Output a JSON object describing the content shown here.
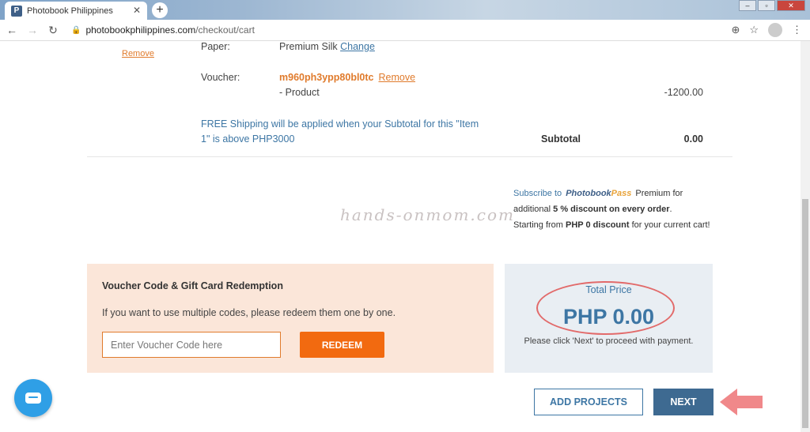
{
  "browser": {
    "tab_title": "Photobook Philippines",
    "favicon_letter": "P",
    "url_host": "photobookphilippines.com",
    "url_path": "/checkout/cart"
  },
  "cart": {
    "remove_label": "Remove",
    "paper_label": "Paper:",
    "paper_value": "Premium Silk",
    "change_label": "Change",
    "voucher_label": "Voucher:",
    "voucher_code": "m960ph3ypp80bl0tc",
    "voucher_remove_label": "Remove",
    "product_discount_label": "- Product",
    "product_discount_amount": "-1200.00",
    "shipping_note": "FREE Shipping will be applied when your Subtotal for this \"Item 1\" is above PHP3000",
    "subtotal_label": "Subtotal",
    "subtotal_value": "0.00"
  },
  "watermark": "hands-onmom.com",
  "promo": {
    "subscribe_to": "Subscribe to",
    "brand": "Photobook",
    "brand_suffix": "Pass",
    "premium_for": "Premium for",
    "additional": "additional",
    "discount_pct": "5 % discount on every order",
    "starting_from": "Starting from",
    "php_discount": "PHP 0 discount",
    "for_cart": "for your current cart!"
  },
  "voucher_panel": {
    "title": "Voucher Code & Gift Card Redemption",
    "description": "If you want to use multiple codes, please redeem them one by one.",
    "input_placeholder": "Enter Voucher Code here",
    "redeem_label": "REDEEM"
  },
  "total_panel": {
    "label": "Total Price",
    "price": "PHP 0.00",
    "note": "Please click 'Next' to proceed with payment."
  },
  "actions": {
    "add_projects_label": "ADD PROJECTS",
    "next_label": "NEXT"
  },
  "icons": {
    "chat": "chat-icon",
    "arrow": "arrow-left-icon"
  },
  "colors": {
    "accent_orange": "#f26a10",
    "link_blue": "#3d76a4",
    "next_blue": "#3e6a91",
    "annotation_red": "#e26a6a"
  }
}
